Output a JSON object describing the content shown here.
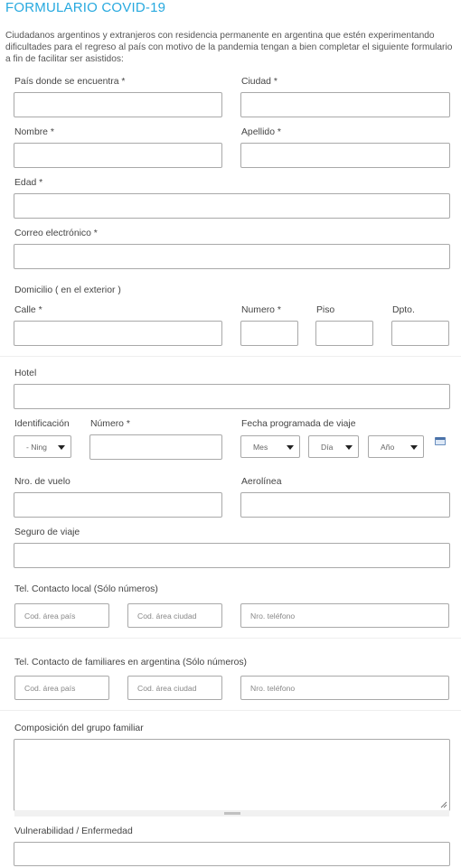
{
  "form": {
    "title": "FORMULARIO COVID-19",
    "intro": "Ciudadanos argentinos y extranjeros con residencia permanente en argentina que estén experimentando dificultades para el regreso al país con motivo de la pandemia tengan a bien completar el siguiente formulario a fin de facilitar ser asistidos:"
  },
  "labels": {
    "pais": "País donde se encuentra *",
    "ciudad": "Ciudad *",
    "nombre": "Nombre *",
    "apellido": "Apellido *",
    "edad": "Edad *",
    "correo": "Correo electrónico *",
    "domicilio": "Domicilio ( en el exterior )",
    "calle": "Calle *",
    "numero_dom": "Numero *",
    "piso": "Piso",
    "dpto": "Dpto.",
    "hotel": "Hotel",
    "identificacion": "Identificación",
    "numero_id": "Número *",
    "fecha_viaje": "Fecha programada de viaje",
    "vuelo": "Nro. de vuelo",
    "aerolinea": "Aerolínea",
    "seguro": "Seguro de viaje",
    "tel_local": "Tel. Contacto local (Sólo números)",
    "tel_familiares": "Tel. Contacto de familiares en argentina (Sólo números)",
    "grupo_familiar": "Composición del grupo familiar",
    "vulnerabilidad": "Vulnerabilidad / Enfermedad"
  },
  "selects": {
    "identificacion": "- Ning",
    "mes": "Mes",
    "dia": "Día",
    "anio": "Año"
  },
  "placeholders": {
    "cod_area_pais": "Cod. área país",
    "cod_area_ciudad": "Cod. área ciudad",
    "nro_telefono": "Nro. teléfono"
  },
  "colors": {
    "title": "#27a9df",
    "border": "#a9a9a9"
  },
  "icons": {
    "calendar": "calendar-icon"
  }
}
